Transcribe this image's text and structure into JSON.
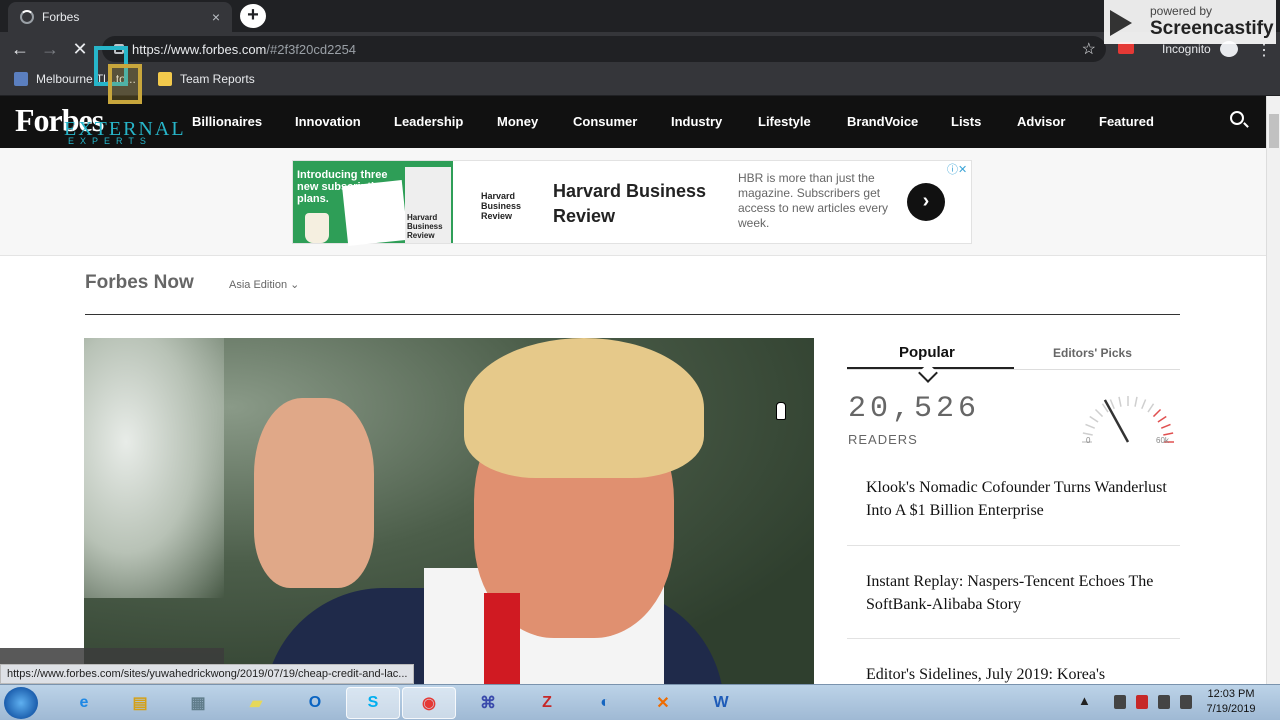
{
  "browser": {
    "tab_title": "Forbes",
    "tab_close": "×",
    "new_tab": "+",
    "url_main": "https://www.forbes.com",
    "url_rest": "/#2f3f20cd2254",
    "incognito_label": "Incognito",
    "back": "←",
    "forward": "→",
    "stop": "✕",
    "star": "☆",
    "kebab": "⋮",
    "bookmarks": [
      {
        "label": "Melbourne Tl...to...",
        "color": "#5b7fbf"
      },
      {
        "label": "Team Reports",
        "color": "#f2c94c"
      }
    ]
  },
  "watermark": {
    "powered": "powered by",
    "brand": "Screencastify"
  },
  "forbes_nav": {
    "logo": "Forbes",
    "overlay_text": "EXTERNAL",
    "overlay_text2": "EXPERTS",
    "items": [
      "Billionaires",
      "Innovation",
      "Leadership",
      "Money",
      "Consumer",
      "Industry",
      "Lifestyle",
      "BrandVoice",
      "Lists",
      "Advisor",
      "Featured"
    ]
  },
  "ad": {
    "promo_text": "Introducing three new subscription plans.",
    "mag_text": "Harvard Business Review",
    "hbr_small": "Harvard Business Review",
    "title": "Harvard Business Review",
    "description": "HBR is more than just the magazine. Subscribers get access to new articles every week.",
    "arrow": "›",
    "choices": "ⓘ✕"
  },
  "section": {
    "title": "Forbes Now",
    "edition": "Asia Edition ⌄"
  },
  "sidebar": {
    "tab_popular": "Popular",
    "tab_editors": "Editors' Picks",
    "readers_count": "20,526",
    "readers_label": "READERS",
    "gauge_min": "0",
    "gauge_max": "60k",
    "gauge_fraction": 0.34,
    "stories": [
      "Klook's Nomadic Cofounder Turns Wanderlust Into A $1 Billion Enterprise",
      "Instant Replay: Naspers-Tencent Echoes The SoftBank-Alibaba Story",
      "Editor's Sidelines, July 2019: Korea's"
    ]
  },
  "status_url": "https://www.forbes.com/sites/yuwahedrickwong/2019/07/19/cheap-credit-and-lac...",
  "taskbar": {
    "apps": [
      {
        "name": "internet-explorer",
        "glyph": "e",
        "color": "#1e88e5"
      },
      {
        "name": "file-explorer",
        "glyph": "▤",
        "color": "#d4a017"
      },
      {
        "name": "calculator",
        "glyph": "▦",
        "color": "#607d8b"
      },
      {
        "name": "sticky-notes",
        "glyph": "▰",
        "color": "#e6d85a"
      },
      {
        "name": "outlook",
        "glyph": "O",
        "color": "#0a64c2"
      },
      {
        "name": "skype",
        "glyph": "S",
        "color": "#00aff0"
      },
      {
        "name": "chrome",
        "glyph": "◉",
        "color": "#e53935"
      },
      {
        "name": "network-tool",
        "glyph": "⌘",
        "color": "#3949ab"
      },
      {
        "name": "filezilla",
        "glyph": "Z",
        "color": "#c62828"
      },
      {
        "name": "thunderbird",
        "glyph": "◐",
        "color": "#1565c0"
      },
      {
        "name": "xampp",
        "glyph": "✕",
        "color": "#ef6c00"
      },
      {
        "name": "word",
        "glyph": "W",
        "color": "#1e5bb8"
      }
    ],
    "time": "12:03 PM",
    "date": "7/19/2019",
    "tray_arrow": "▲"
  }
}
